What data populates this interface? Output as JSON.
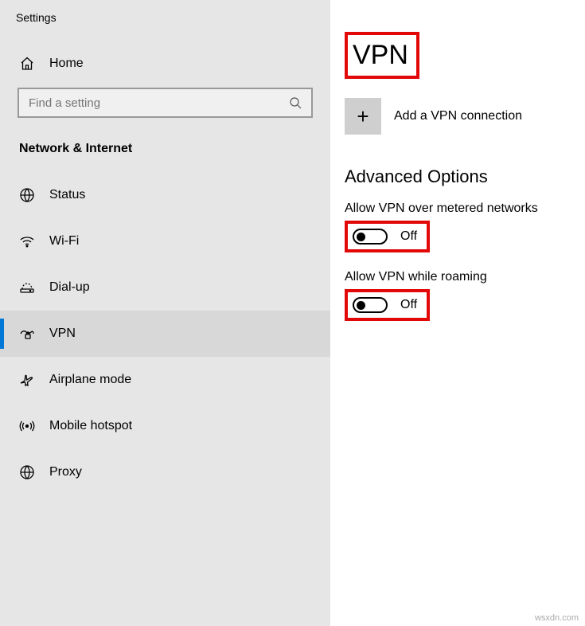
{
  "app_title": "Settings",
  "home_label": "Home",
  "search": {
    "placeholder": "Find a setting"
  },
  "category_header": "Network & Internet",
  "nav": {
    "items": [
      {
        "label": "Status"
      },
      {
        "label": "Wi-Fi"
      },
      {
        "label": "Dial-up"
      },
      {
        "label": "VPN"
      },
      {
        "label": "Airplane mode"
      },
      {
        "label": "Mobile hotspot"
      },
      {
        "label": "Proxy"
      }
    ]
  },
  "page_title": "VPN",
  "add_vpn_label": "Add a VPN connection",
  "advanced_header": "Advanced Options",
  "options": {
    "metered": {
      "label": "Allow VPN over metered networks",
      "state": "Off"
    },
    "roaming": {
      "label": "Allow VPN while roaming",
      "state": "Off"
    }
  },
  "watermark": "wsxdn.com"
}
